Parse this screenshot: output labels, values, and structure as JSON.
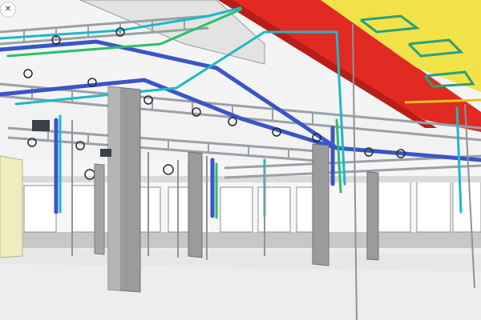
{
  "viewer": {
    "close_label": "✕",
    "close_icon": "close-icon"
  },
  "palette": {
    "duct_red": "#e02a22",
    "duct_yellow": "#f2e24a",
    "pipe_blue": "#3a55c8",
    "pipe_cyan": "#1fb7c9",
    "pipe_green": "#2bbf6a",
    "steel_gray": "#8e9399",
    "column_gray": "#9b9b9b",
    "wall_yellow": "#f2efc6",
    "floor_gray": "#ececec"
  }
}
